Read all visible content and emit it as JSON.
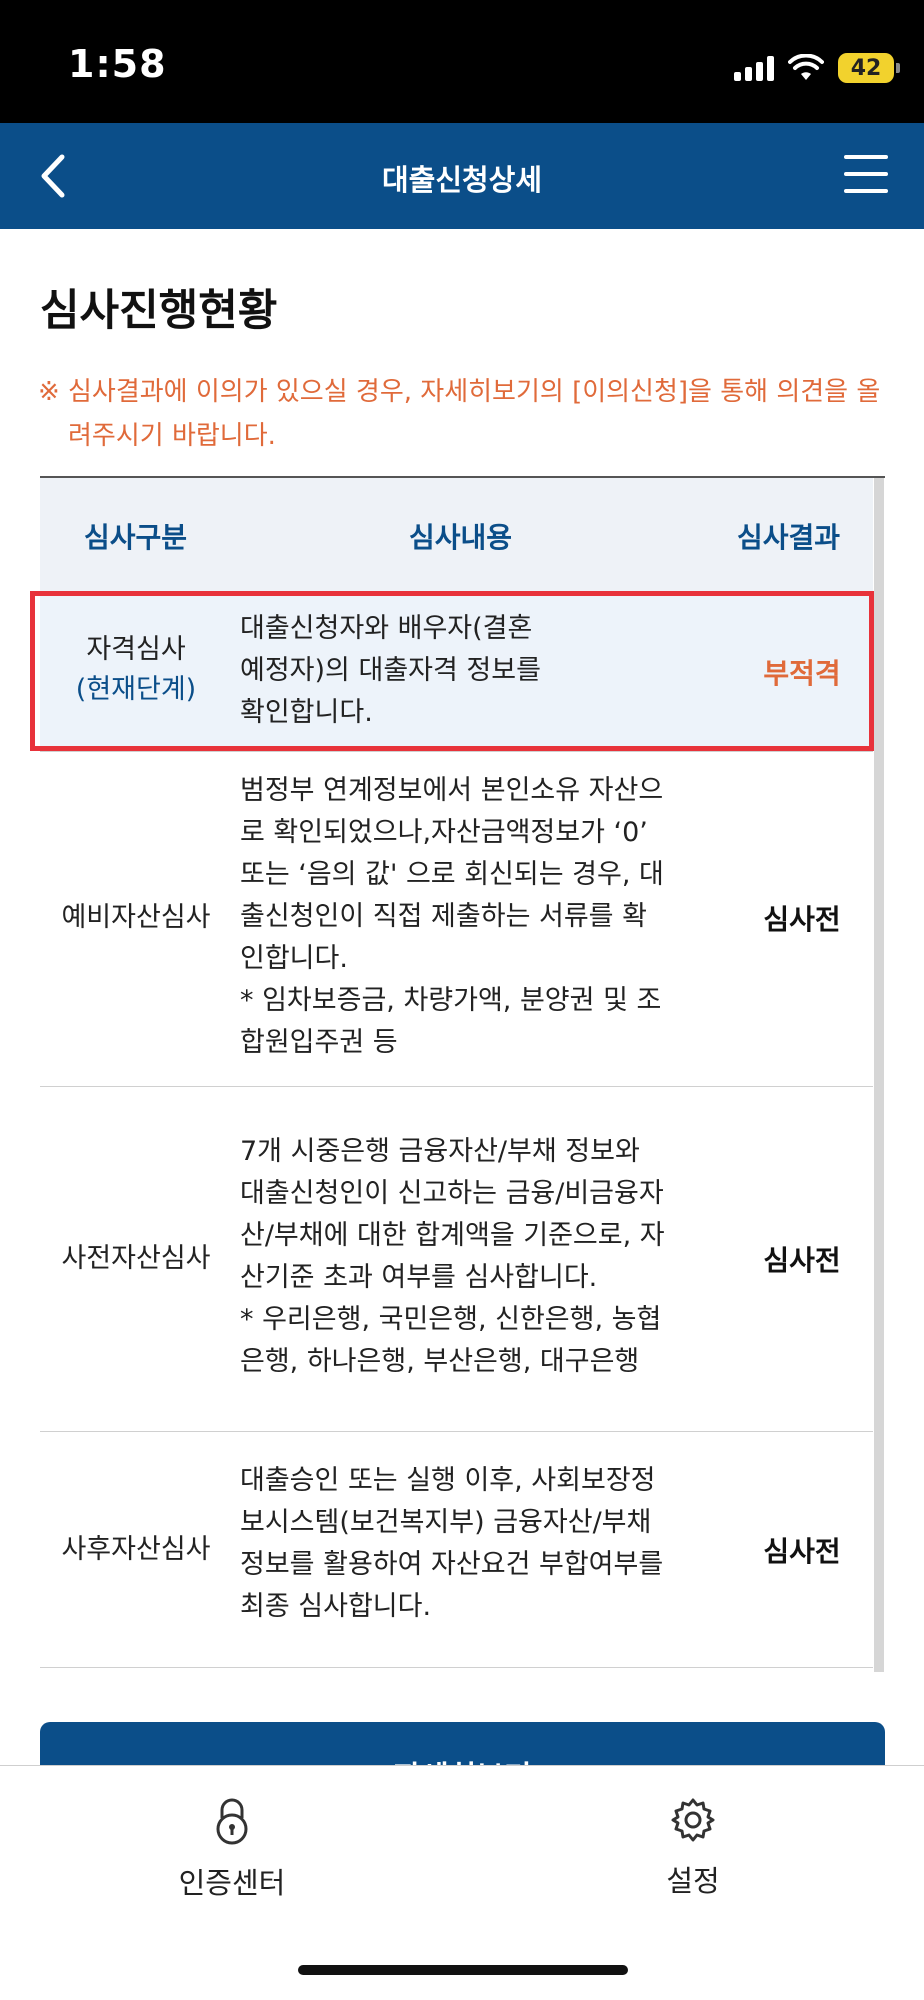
{
  "status_bar": {
    "time": "1:58",
    "battery": "42"
  },
  "header": {
    "title": "대출신청상세"
  },
  "section": {
    "title": "심사진행현황",
    "notice_mark": "※",
    "notice_text": "심사결과에 이의가 있으실 경우, 자세히보기의 [이의신청]을 통해 의견을 올려주시기 바랍니다."
  },
  "table": {
    "headers": [
      "심사구분",
      "심사내용",
      "심사결과"
    ],
    "rows": [
      {
        "type": "자격심사",
        "stage": "(현재단계)",
        "desc_lines": [
          "대출신청자와 배우자(결혼",
          "예정자)의 대출자격 정보를",
          "확인합니다."
        ],
        "result": "부적격"
      },
      {
        "type": "예비자산심사",
        "desc_lines": [
          "범정부 연계정보에서 본인소유 자산으",
          "로 확인되었으나,자산금액정보가 ‘0’",
          "또는 ‘음의 값' 으로 회신되는 경우, 대",
          "출신청인이 직접 제출하는 서류를 확",
          "인합니다.",
          "* 임차보증금, 차량가액, 분양권 및 조",
          "합원입주권 등"
        ],
        "result": "심사전"
      },
      {
        "type": "사전자산심사",
        "desc_lines": [
          "7개 시중은행 금융자산/부채 정보와",
          "대출신청인이 신고하는 금융/비금융자",
          "산/부채에 대한 합계액을 기준으로, 자",
          "산기준 초과 여부를 심사합니다.",
          "* 우리은행, 국민은행, 신한은행, 농협",
          "은행, 하나은행, 부산은행, 대구은행"
        ],
        "result": "심사전"
      },
      {
        "type": "사후자산심사",
        "desc_lines": [
          "대출승인 또는 실행 이후, 사회보장정",
          "보시스템(보건복지부) 금융자산/부채",
          "정보를 활용하여 자산요건 부합여부를",
          "최종 심사합니다."
        ],
        "result": "심사전"
      }
    ]
  },
  "detail_button": {
    "label": "자세히보기"
  },
  "bottom_nav": {
    "items": [
      {
        "label": "인증센터",
        "icon": "lock-icon"
      },
      {
        "label": "설정",
        "icon": "gear-icon"
      }
    ]
  },
  "colors": {
    "header_bg": "#0b4e89",
    "notice": "#e06a3a",
    "result_fail": "#e06a3a",
    "highlight_border": "#e8323a"
  }
}
